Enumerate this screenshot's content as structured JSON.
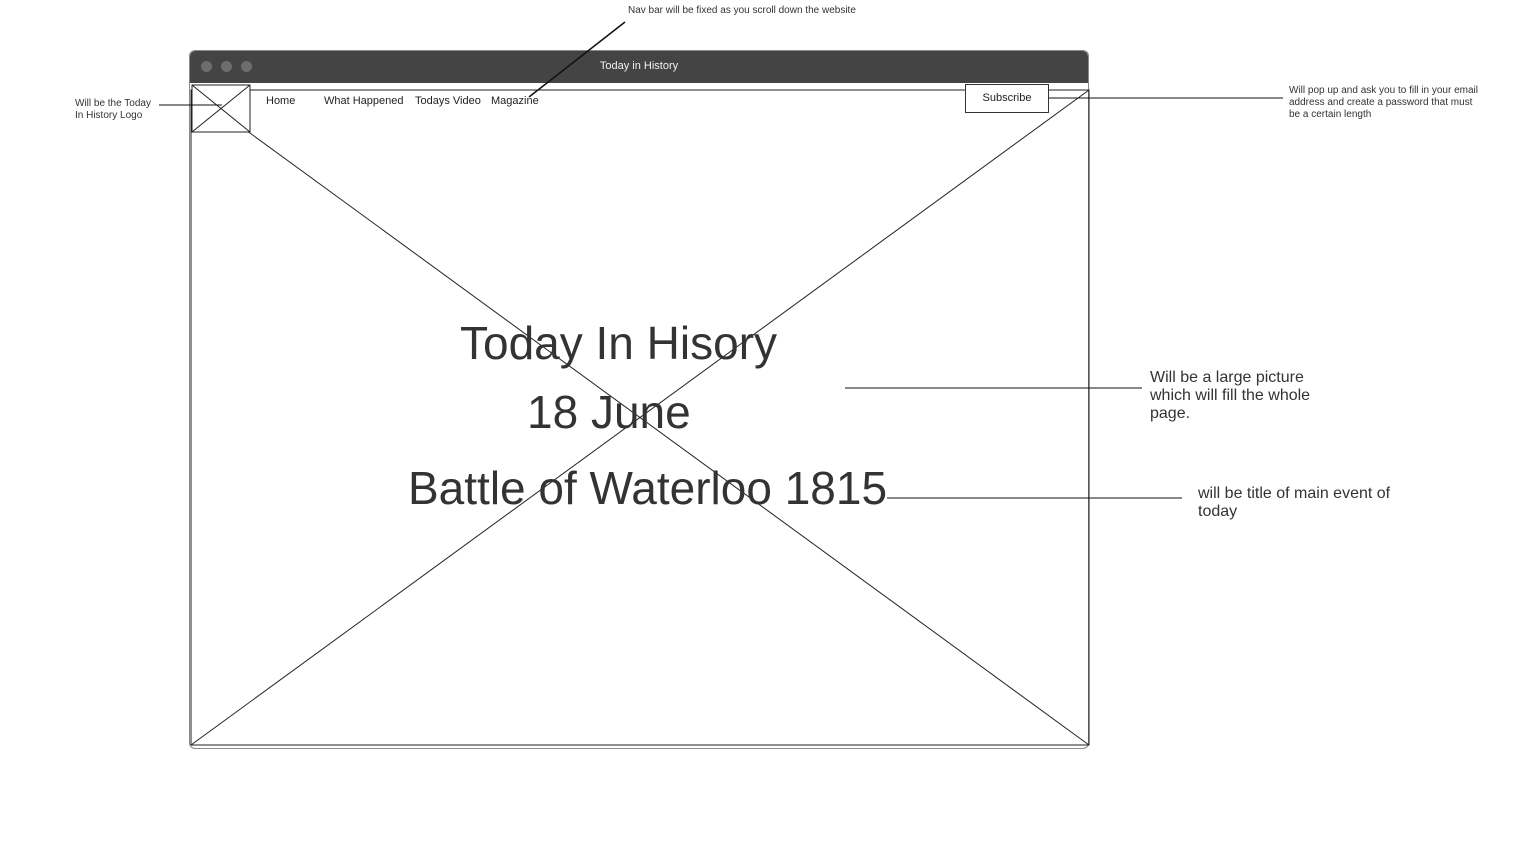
{
  "window": {
    "title": "Today in History"
  },
  "nav": {
    "items": [
      "Home",
      "What Happened",
      "Todays Video",
      "Magazine"
    ],
    "subscribe_label": "Subscribe"
  },
  "hero": {
    "title": "Today In Hisory",
    "date": "18 June",
    "event": "Battle of Waterloo 1815"
  },
  "annotations": {
    "nav_fixed": "Nav bar will be fixed as you scroll down the website",
    "logo": "Will be the Today In History Logo",
    "subscribe": "Will pop up and ask you to fill in your email address and create a password that must be a certain length",
    "picture": "Will be a large picture which will fill the whole page.",
    "event_title": "will be title of main event of today"
  }
}
